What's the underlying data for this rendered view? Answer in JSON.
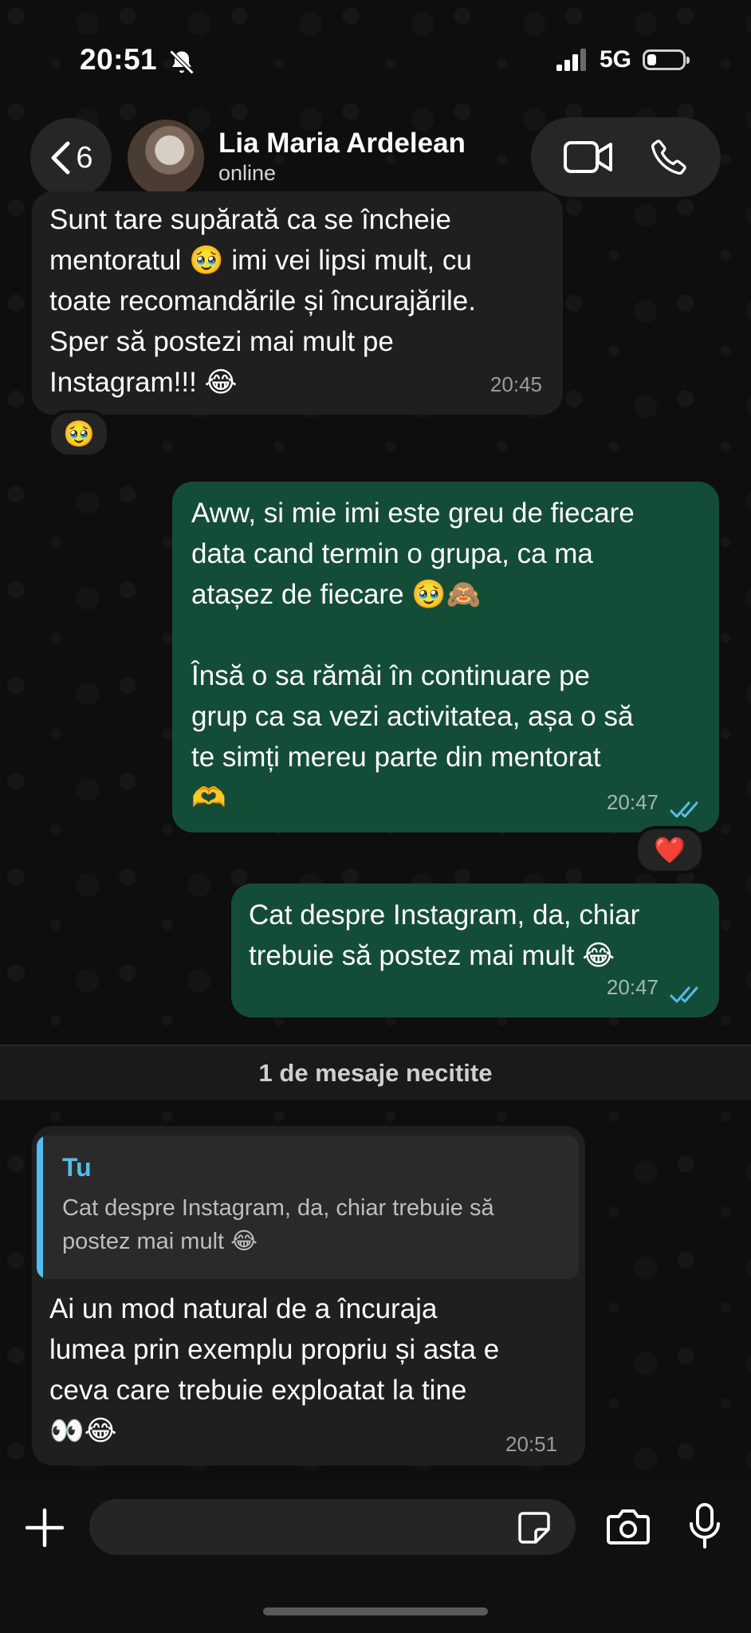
{
  "status_bar": {
    "time": "20:51",
    "network": "5G",
    "battery_level": 0.25
  },
  "header": {
    "back_count": "6",
    "contact_name": "Lia Maria Ardelean",
    "contact_status": "online"
  },
  "messages": [
    {
      "direction": "incoming",
      "text": "Sunt tare supărată ca se încheie\nmentoratul 🥹 imi vei lipsi mult, cu\ntoate recomandările și încurajările.\nSper să postezi mai mult pe\nInstagram!!! 😂",
      "time": "20:45",
      "reaction": "🥹"
    },
    {
      "direction": "outgoing",
      "text": "Aww, si mie imi este greu de fiecare\ndata cand termin o grupa, ca ma\natașez de fiecare 🥹🙈\n\nÎnsă o sa rămâi în continuare pe\ngrup ca sa vezi activitatea, așa o să\nte simți mereu parte din mentorat\n🫶",
      "time": "20:47",
      "reaction": "❤️"
    },
    {
      "direction": "outgoing",
      "text": "Cat despre Instagram, da, chiar\ntrebuie să postez mai mult 😂",
      "time": "20:47"
    },
    {
      "direction": "incoming",
      "quote_author": "Tu",
      "quote_text": "Cat despre Instagram, da, chiar trebuie să postez mai mult 😂",
      "text": "Ai un mod natural de a încuraja\nlumea prin exemplu propriu și asta e\nceva care trebuie exploatat la tine\n👀😂",
      "time": "20:51"
    }
  ],
  "unread_divider": "1 de mesaje necitite",
  "input": {
    "placeholder": ""
  }
}
